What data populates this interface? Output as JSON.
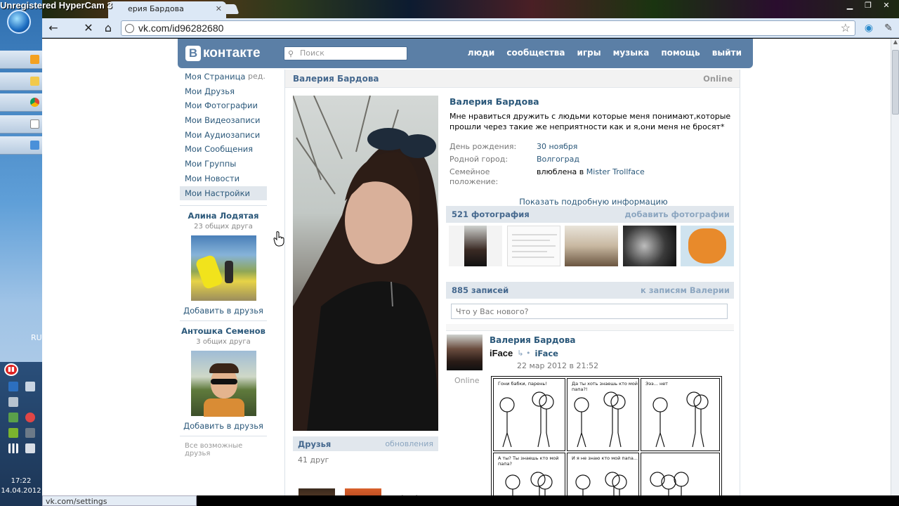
{
  "recorder": {
    "watermark": "Unregistered HyperCam 3"
  },
  "browser": {
    "tab_title": "ерия Бардова",
    "url": "vk.com/id96282680",
    "status_url": "vk.com/settings"
  },
  "taskbar": {
    "language": "RU",
    "time": "17:22",
    "date": "14.04.2012"
  },
  "vk": {
    "logo": "контакте",
    "logo_mark": "В",
    "search_placeholder": "Поиск",
    "nav": [
      "люди",
      "сообщества",
      "игры",
      "музыка",
      "помощь",
      "выйти"
    ],
    "menu": [
      "Моя Страница",
      "Мои Друзья",
      "Мои Фотографии",
      "Мои Видеозаписи",
      "Мои Аудиозаписи",
      "Мои Сообщения",
      "Мои Группы",
      "Мои Новости",
      "Мои Настройки"
    ],
    "edit_link": "ред.",
    "suggestions": [
      {
        "name": "Алина Лодятая",
        "common": "23 общих друга",
        "add": "Добавить в друзья"
      },
      {
        "name": "Антошка Семенов",
        "common": "3 общих друга",
        "add": "Добавить в друзья"
      }
    ],
    "all_friends": "Все возможные друзья"
  },
  "profile": {
    "header_name": "Валерия Бардова",
    "header_online": "Online",
    "name": "Валерия Бардова",
    "status": "Мне нравиться дружить с людьми которые меня понимают,которые прошли через такие же неприятности как и я,они меня не бросят*",
    "birthday_label": "День рождения:",
    "birthday": "30 ноября",
    "city_label": "Родной город:",
    "city": "Волгоград",
    "family_label": "Семейное положение:",
    "family_prefix": "влюблена в",
    "family_person": "Mister Trollface",
    "show_more": "Показать подробную информацию",
    "photos_title": "521 фотография",
    "photos_add": "добавить фотографии",
    "wall_title": "885 записей",
    "wall_link": "к записям Валерии",
    "wall_placeholder": "Что у Вас нового?",
    "friends_title": "Друзья",
    "friends_updates": "обновления",
    "friends_count": "41 друг"
  },
  "post": {
    "author": "Валерия Бардова",
    "app_name": "iFace",
    "repost_from": "iFace",
    "date": "22 мар 2012 в 21:52",
    "online": "Online",
    "comic_texts": [
      "Гони бабки, парень!",
      "Да ты хоть знаешь кто мой папа?!",
      "Эээ... нет",
      "А ты? Ты знаешь кто мой папа?",
      "И я не знаю кто мой папа...",
      ""
    ]
  }
}
